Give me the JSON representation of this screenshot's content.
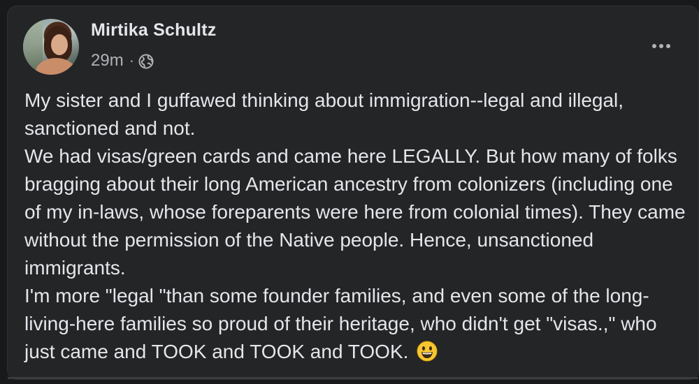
{
  "post": {
    "author": "Mirtika Schultz",
    "timestamp": "29m",
    "separator": "·",
    "privacy_icon": "globe-icon",
    "more_icon": "more-options-icon",
    "paragraphs": [
      "My sister and I guffawed thinking about immigration--legal and illegal, sanctioned and not.",
      "We had visas/green cards and came here LEGALLY. But how many of folks bragging about their long American ancestry from colonizers (including one of my in-laws, whose foreparents were here from colonial times). They came without the permission of the Native people. Hence, unsanctioned immigrants.",
      "I'm more \"legal \"than some founder families, and even some of the long-living-here families so proud of their heritage, who didn't get \"visas.,\" who just came and TOOK and TOOK and TOOK."
    ],
    "trailing_emoji": "grinning-face-emoji"
  },
  "colors": {
    "background": "#18191a",
    "card": "#242526",
    "primary_text": "#e4e6eb",
    "secondary_text": "#b0b3b8"
  }
}
